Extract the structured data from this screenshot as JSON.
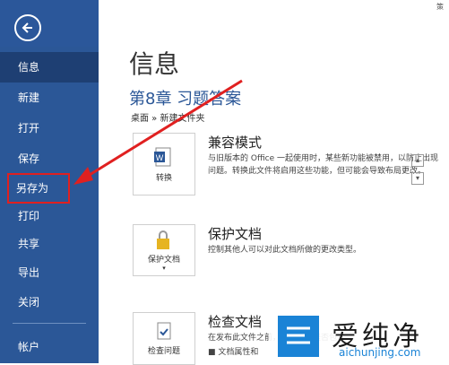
{
  "window": {
    "title_fragment": "策"
  },
  "sidebar": {
    "back_icon": "back-arrow-icon",
    "items": [
      {
        "label": "信息",
        "active": true
      },
      {
        "label": "新建"
      },
      {
        "label": "打开"
      },
      {
        "label": "保存"
      },
      {
        "label": "另存为",
        "highlighted": true
      },
      {
        "label": "打印"
      },
      {
        "label": "共享"
      },
      {
        "label": "导出"
      },
      {
        "label": "关闭"
      },
      {
        "label": "帐户"
      }
    ]
  },
  "main": {
    "page_title": "信息",
    "doc_title": "第8章 习题答案",
    "breadcrumb": "桌面 » 新建文件夹",
    "sections": [
      {
        "tile_label": "转换",
        "title": "兼容模式",
        "desc": "与旧版本的 Office 一起使用时，某些新功能被禁用，以防止出现问题。转换此文件将启用这些功能，但可能会导致布局更改。",
        "icon": "word-convert-icon"
      },
      {
        "tile_label": "保护文档",
        "title": "保护文档",
        "desc": "控制其他人可以对此文档所做的更改类型。",
        "icon": "lock-key-icon"
      },
      {
        "tile_label": "检查问题",
        "title": "检查文档",
        "desc": "在发布此文件之前，请注意其是否包含：",
        "sub": "■ 文档属性和",
        "icon": "check-document-icon"
      }
    ]
  },
  "watermark": {
    "text": "爱纯净",
    "url": "aichunjing.com"
  },
  "colors": {
    "sidebar": "#2b5797",
    "accent_text": "#2b5797",
    "arrow": "#e02020"
  }
}
